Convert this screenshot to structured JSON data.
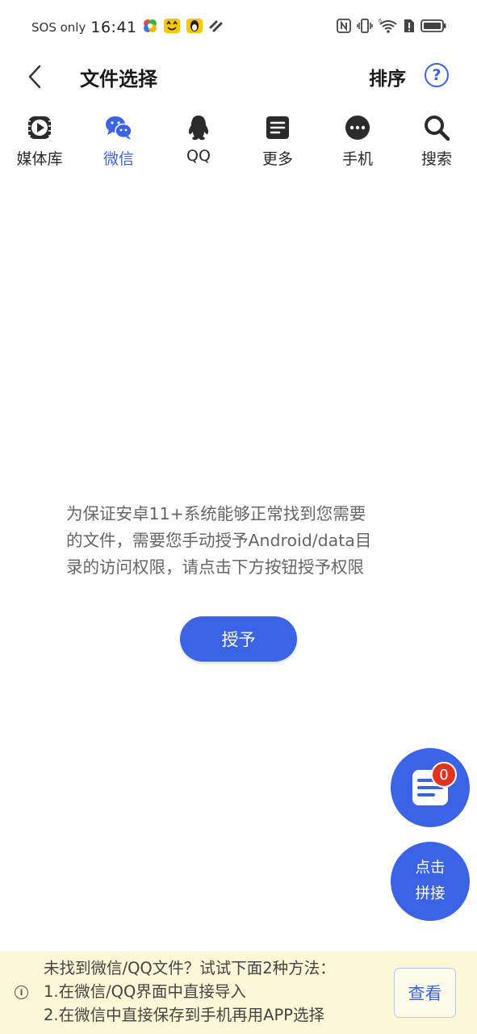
{
  "status_bar": {
    "carrier": "SOS only",
    "time": "16:41",
    "network": "6",
    "icons": [
      "app-pinwheel-icon",
      "app-emoji-icon",
      "app-penguin-icon",
      "app-link-icon",
      "nfc-icon",
      "vibrate-icon",
      "wifi-icon",
      "sim-alert-icon",
      "battery-icon"
    ]
  },
  "header": {
    "title": "文件选择",
    "sort_label": "排序",
    "help_label": "?"
  },
  "tabs": [
    {
      "label": "媒体库",
      "icon": "media-library-icon"
    },
    {
      "label": "微信",
      "icon": "wechat-icon",
      "active": true
    },
    {
      "label": "QQ",
      "icon": "qq-penguin-icon"
    },
    {
      "label": "更多",
      "icon": "document-icon"
    },
    {
      "label": "手机",
      "icon": "more-dots-icon"
    },
    {
      "label": "搜索",
      "icon": "search-icon"
    }
  ],
  "main": {
    "permission_message": "为保证安卓11+系统能够正常找到您需要\n的文件，需要您手动授予Android/data目\n录的访问权限，请点击下方按钮授予权限",
    "grant_button": "授予"
  },
  "fab": {
    "list_badge": "0",
    "merge_line1": "点击",
    "merge_line2": "拼接"
  },
  "tip": {
    "info_icon": "i",
    "line1": "未找到微信/QQ文件？试试下面2种方法：",
    "line2": "1.在微信/QQ界面中直接导入",
    "line3": "2.在微信中直接保存到手机再用APP选择",
    "view_button": "查看"
  },
  "colors": {
    "accent": "#3a63e6",
    "badge": "#e0321f",
    "tip_background": "#fbf7d7"
  }
}
